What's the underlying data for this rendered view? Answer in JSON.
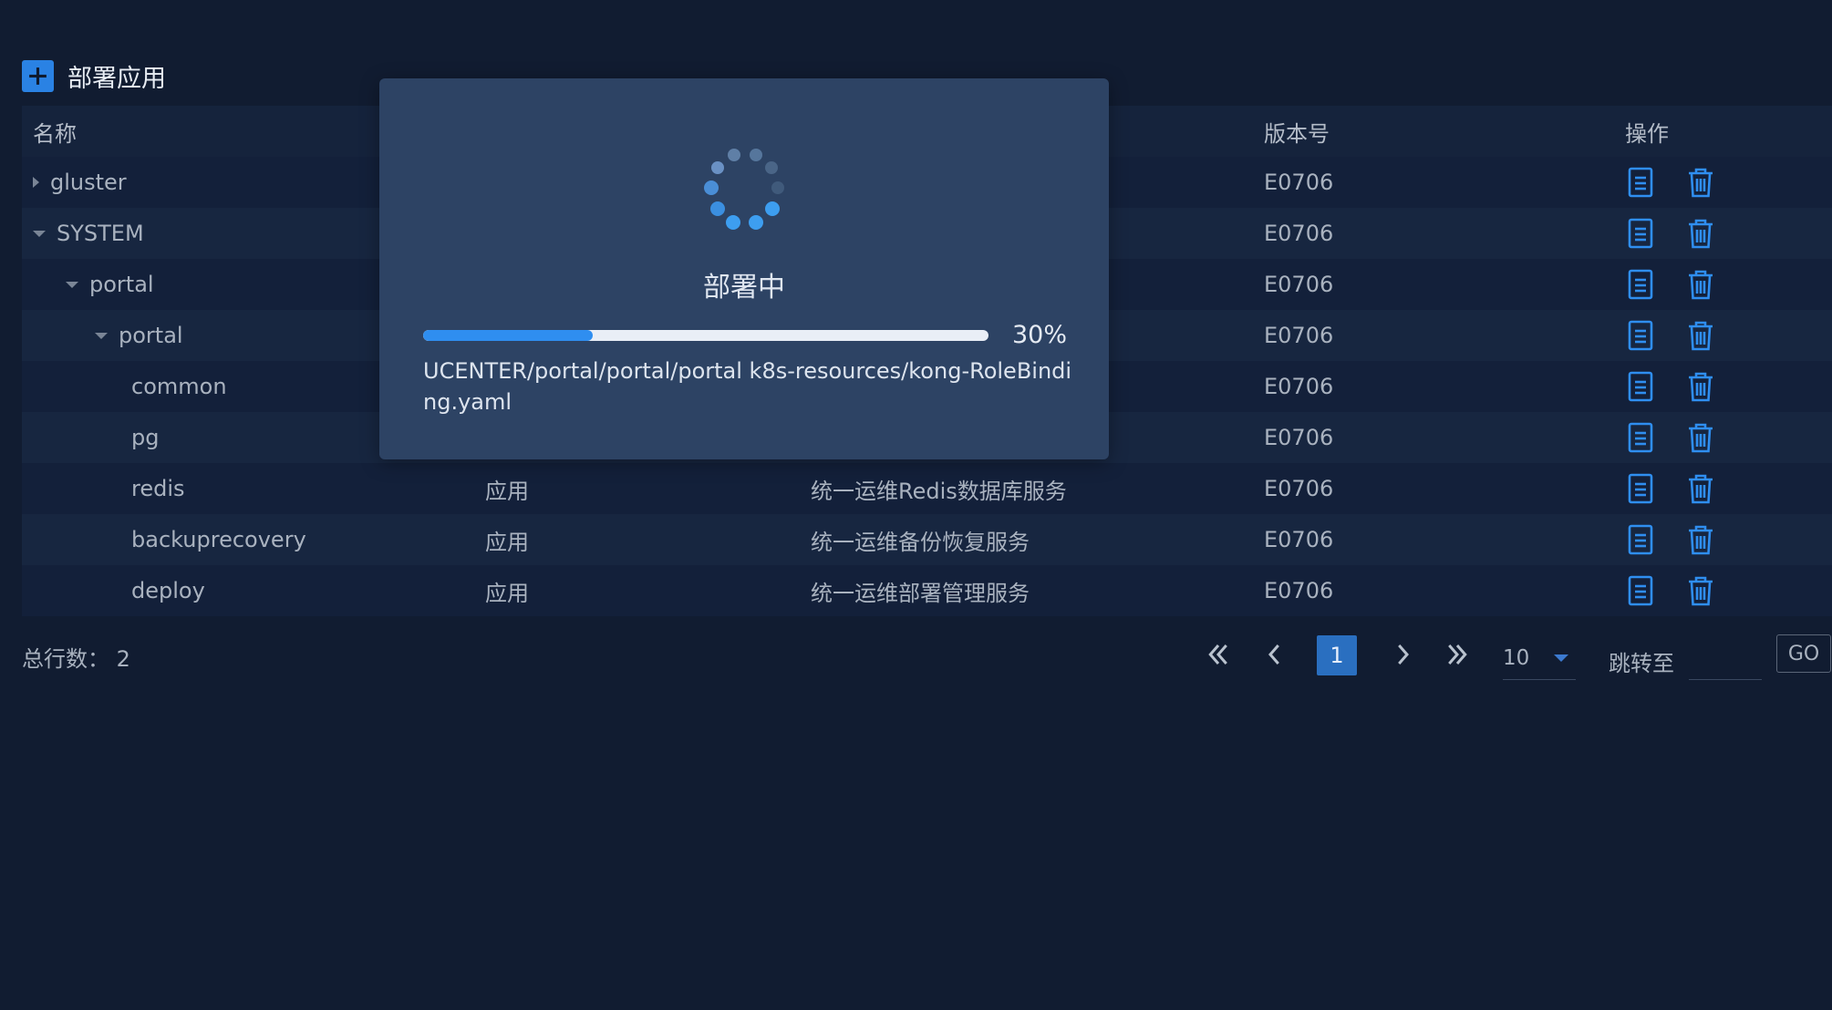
{
  "header": {
    "title": "部署应用",
    "add_icon": "plus-icon"
  },
  "table": {
    "columns": {
      "name": "名称",
      "version": "版本号",
      "ops": "操作"
    },
    "rows": [
      {
        "name": "gluster",
        "type": "",
        "desc": "",
        "version": "E0706",
        "caret": "right",
        "indent": 0
      },
      {
        "name": "SYSTEM",
        "type": "",
        "desc": "",
        "version": "E0706",
        "caret": "down",
        "indent": 0
      },
      {
        "name": "portal",
        "type": "",
        "desc": "",
        "version": "E0706",
        "caret": "down",
        "indent": 1
      },
      {
        "name": "portal",
        "type": "",
        "desc": "",
        "version": "E0706",
        "caret": "down",
        "indent": 2
      },
      {
        "name": "common",
        "type": "",
        "desc": "",
        "version": "E0706",
        "caret": "none",
        "indent": 3
      },
      {
        "name": "pg",
        "type": "",
        "desc": "",
        "version": "E0706",
        "caret": "none",
        "indent": 3
      },
      {
        "name": "redis",
        "type": "应用",
        "desc": "统一运维Redis数据库服务",
        "version": "E0706",
        "caret": "none",
        "indent": 3
      },
      {
        "name": "backuprecovery",
        "type": "应用",
        "desc": "统一运维备份恢复服务",
        "version": "E0706",
        "caret": "none",
        "indent": 3
      },
      {
        "name": "deploy",
        "type": "应用",
        "desc": "统一运维部署管理服务",
        "version": "E0706",
        "caret": "none",
        "indent": 3
      }
    ]
  },
  "footer": {
    "total_label": "总行数： 2",
    "current_page": "1",
    "page_size": "10",
    "jump_label": "跳转至",
    "jump_value": "",
    "go_label": "GO"
  },
  "modal": {
    "title": "部署中",
    "progress": 0.3,
    "progress_label": "30%",
    "path": "UCENTER/portal/portal/portal k8s-resources/kong-RoleBinding.yaml"
  },
  "colors": {
    "background": "#111c31",
    "accent": "#2a82e4",
    "modal": "#2d4364",
    "progress": "#2f8ef0"
  }
}
